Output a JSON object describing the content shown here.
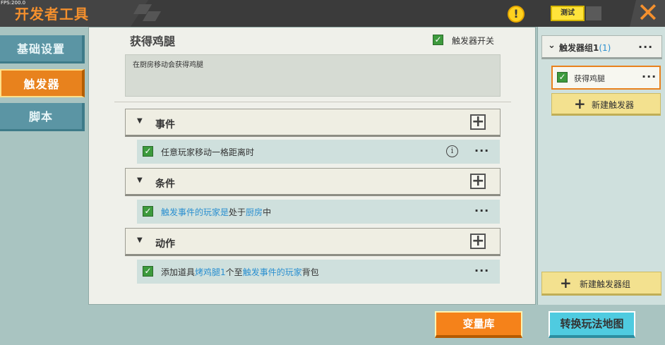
{
  "fps": "FPS:200.0",
  "app_title": "开发者工具",
  "warning_glyph": "!",
  "test_button": "测试",
  "close_glyph": "✕",
  "nav": {
    "basic_settings": "基础设置",
    "triggers": "触发器",
    "scripts": "脚本"
  },
  "trigger": {
    "name": "获得鸡腿",
    "switch_label": "触发器开关",
    "description": "在厨房移动会获得鸡腿"
  },
  "sections": {
    "event": {
      "label": "事件",
      "item": "任意玩家移动一格距离时"
    },
    "condition": {
      "label": "条件",
      "item_part1": "触发事件的玩家",
      "item_part2": "是",
      "item_part3": "处于",
      "item_part4": "厨房",
      "item_part5": "中"
    },
    "action": {
      "label": "动作",
      "item_part1": "添加道具",
      "item_part2": "烤鸡腿",
      "item_part3": "1",
      "item_part4": "个至",
      "item_part5": "触发事件的玩家",
      "item_part6": "背包"
    }
  },
  "right_panel": {
    "group_label": "触发器组1",
    "group_count": "(1)",
    "trigger_item": "获得鸡腿",
    "new_trigger": "新建触发器",
    "new_group": "新建触发器组"
  },
  "bottom": {
    "variable_library": "变量库",
    "switch_map": "转换玩法地图"
  },
  "icons": {
    "checkbox": "✓",
    "expand": "▼",
    "collapse": "⌄",
    "add": "+",
    "info": "i",
    "more": "···"
  },
  "colors": {
    "accent_orange": "#f5821a",
    "highlight_blue": "#2a8fd0",
    "check_green": "#3d9a3d",
    "cyan_button": "#4fcbe0"
  }
}
